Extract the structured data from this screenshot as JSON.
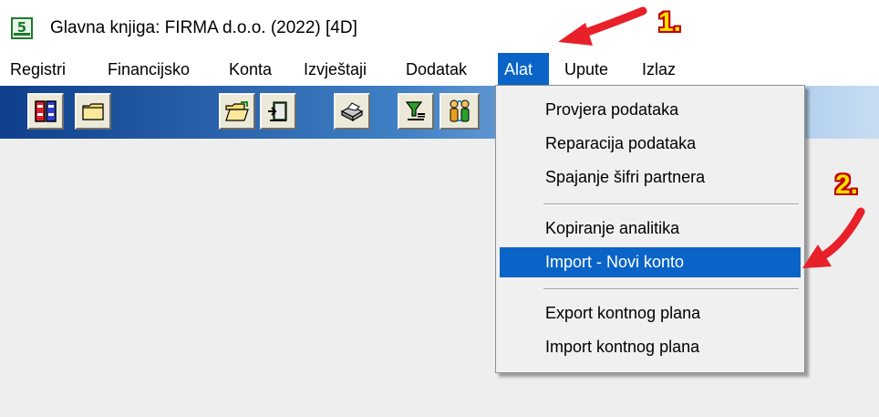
{
  "window": {
    "title": "Glavna knjiga: FIRMA d.o.o. (2022) [4D]",
    "icon": "app-logo-icon"
  },
  "menubar": {
    "items": [
      {
        "label": "Registri"
      },
      {
        "label": "Financijsko"
      },
      {
        "label": "Konta"
      },
      {
        "label": "Izvještaji"
      },
      {
        "label": "Dodatak"
      },
      {
        "label": "Alat",
        "active": true
      },
      {
        "label": "Upute"
      },
      {
        "label": "Izlaz"
      }
    ]
  },
  "toolbar": {
    "buttons": [
      {
        "icon": "binders-icon"
      },
      {
        "icon": "folder-icon"
      },
      {
        "icon": "open-folder-icon"
      },
      {
        "icon": "book-arrow-icon"
      },
      {
        "icon": "printer-icon"
      },
      {
        "icon": "filter-icon"
      },
      {
        "icon": "users-icon"
      }
    ],
    "colors": {
      "start": "#0f3f8c",
      "end": "#c7ddf3"
    }
  },
  "dropdown": {
    "items": [
      {
        "label": "Provjera podataka"
      },
      {
        "label": "Reparacija podataka"
      },
      {
        "label": "Spajanje šifri partnera"
      },
      {
        "label": "Kopiranje analitika"
      },
      {
        "label": "Import - Novi konto",
        "selected": true
      },
      {
        "label": "Export kontnog plana"
      },
      {
        "label": "Import kontnog plana"
      }
    ]
  },
  "annotations": {
    "step1": "1.",
    "step2": "2.",
    "arrow_color": "#e8202a"
  },
  "colors": {
    "highlight": "#0a64c8",
    "content_bg": "#eeeeee"
  }
}
